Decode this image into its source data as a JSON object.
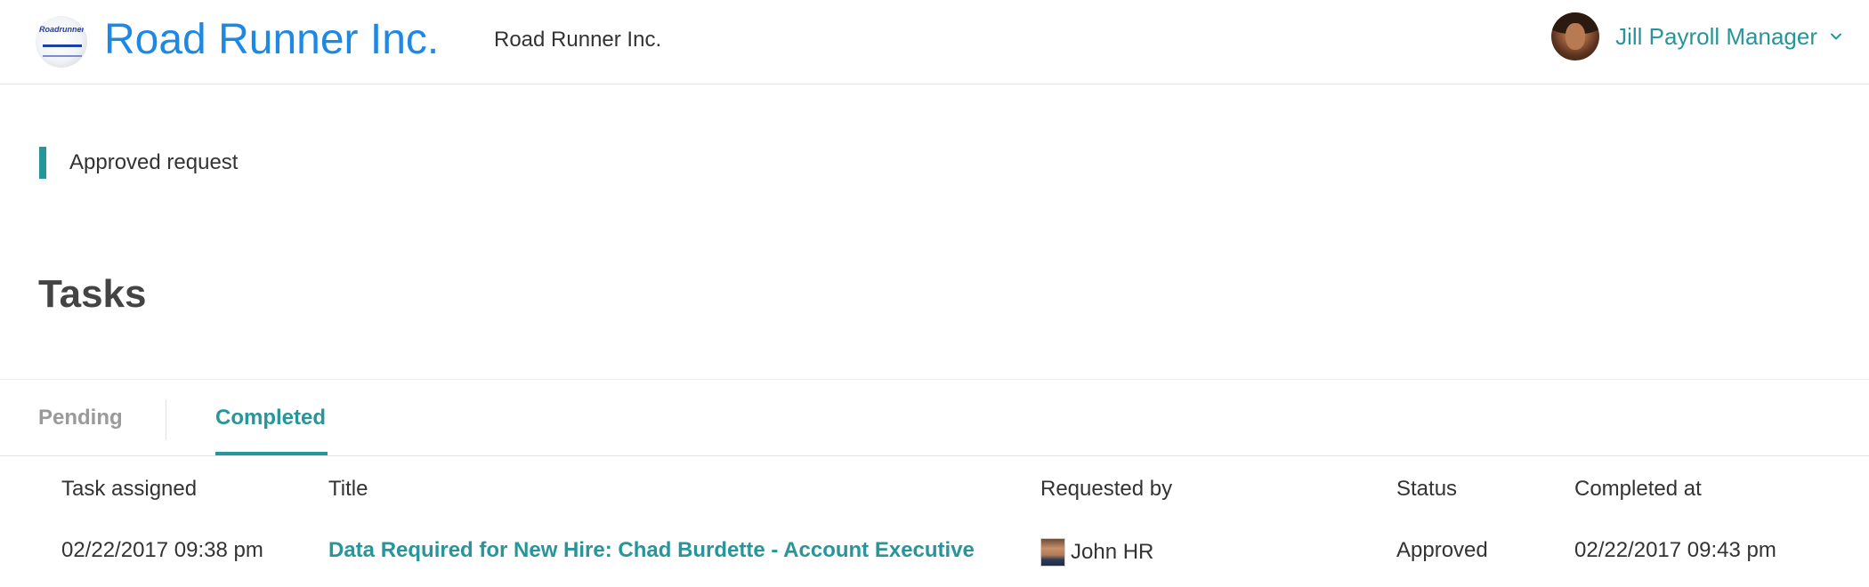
{
  "header": {
    "logo_text": "Roadrunner",
    "company_name": "Road Runner Inc.",
    "company_subtitle": "Road Runner Inc.",
    "user_name": "Jill Payroll Manager",
    "user_menu_icon": "chevron-down-icon"
  },
  "notice": {
    "text": "Approved request"
  },
  "page": {
    "title": "Tasks"
  },
  "tabs": [
    {
      "label": "Pending",
      "active": false
    },
    {
      "label": "Completed",
      "active": true
    }
  ],
  "table": {
    "columns": [
      "Task assigned",
      "Title",
      "Requested by",
      "Status",
      "Completed at"
    ],
    "rows": [
      {
        "task_assigned": "02/22/2017 09:38 pm",
        "title": "Data Required for New Hire: Chad Burdette - Account Executive",
        "requested_by": "John HR",
        "status": "Approved",
        "completed_at": "02/22/2017 09:43 pm"
      }
    ]
  },
  "colors": {
    "brand": "#1e88e5",
    "accent": "#26969a",
    "muted": "#9a9a9a"
  }
}
